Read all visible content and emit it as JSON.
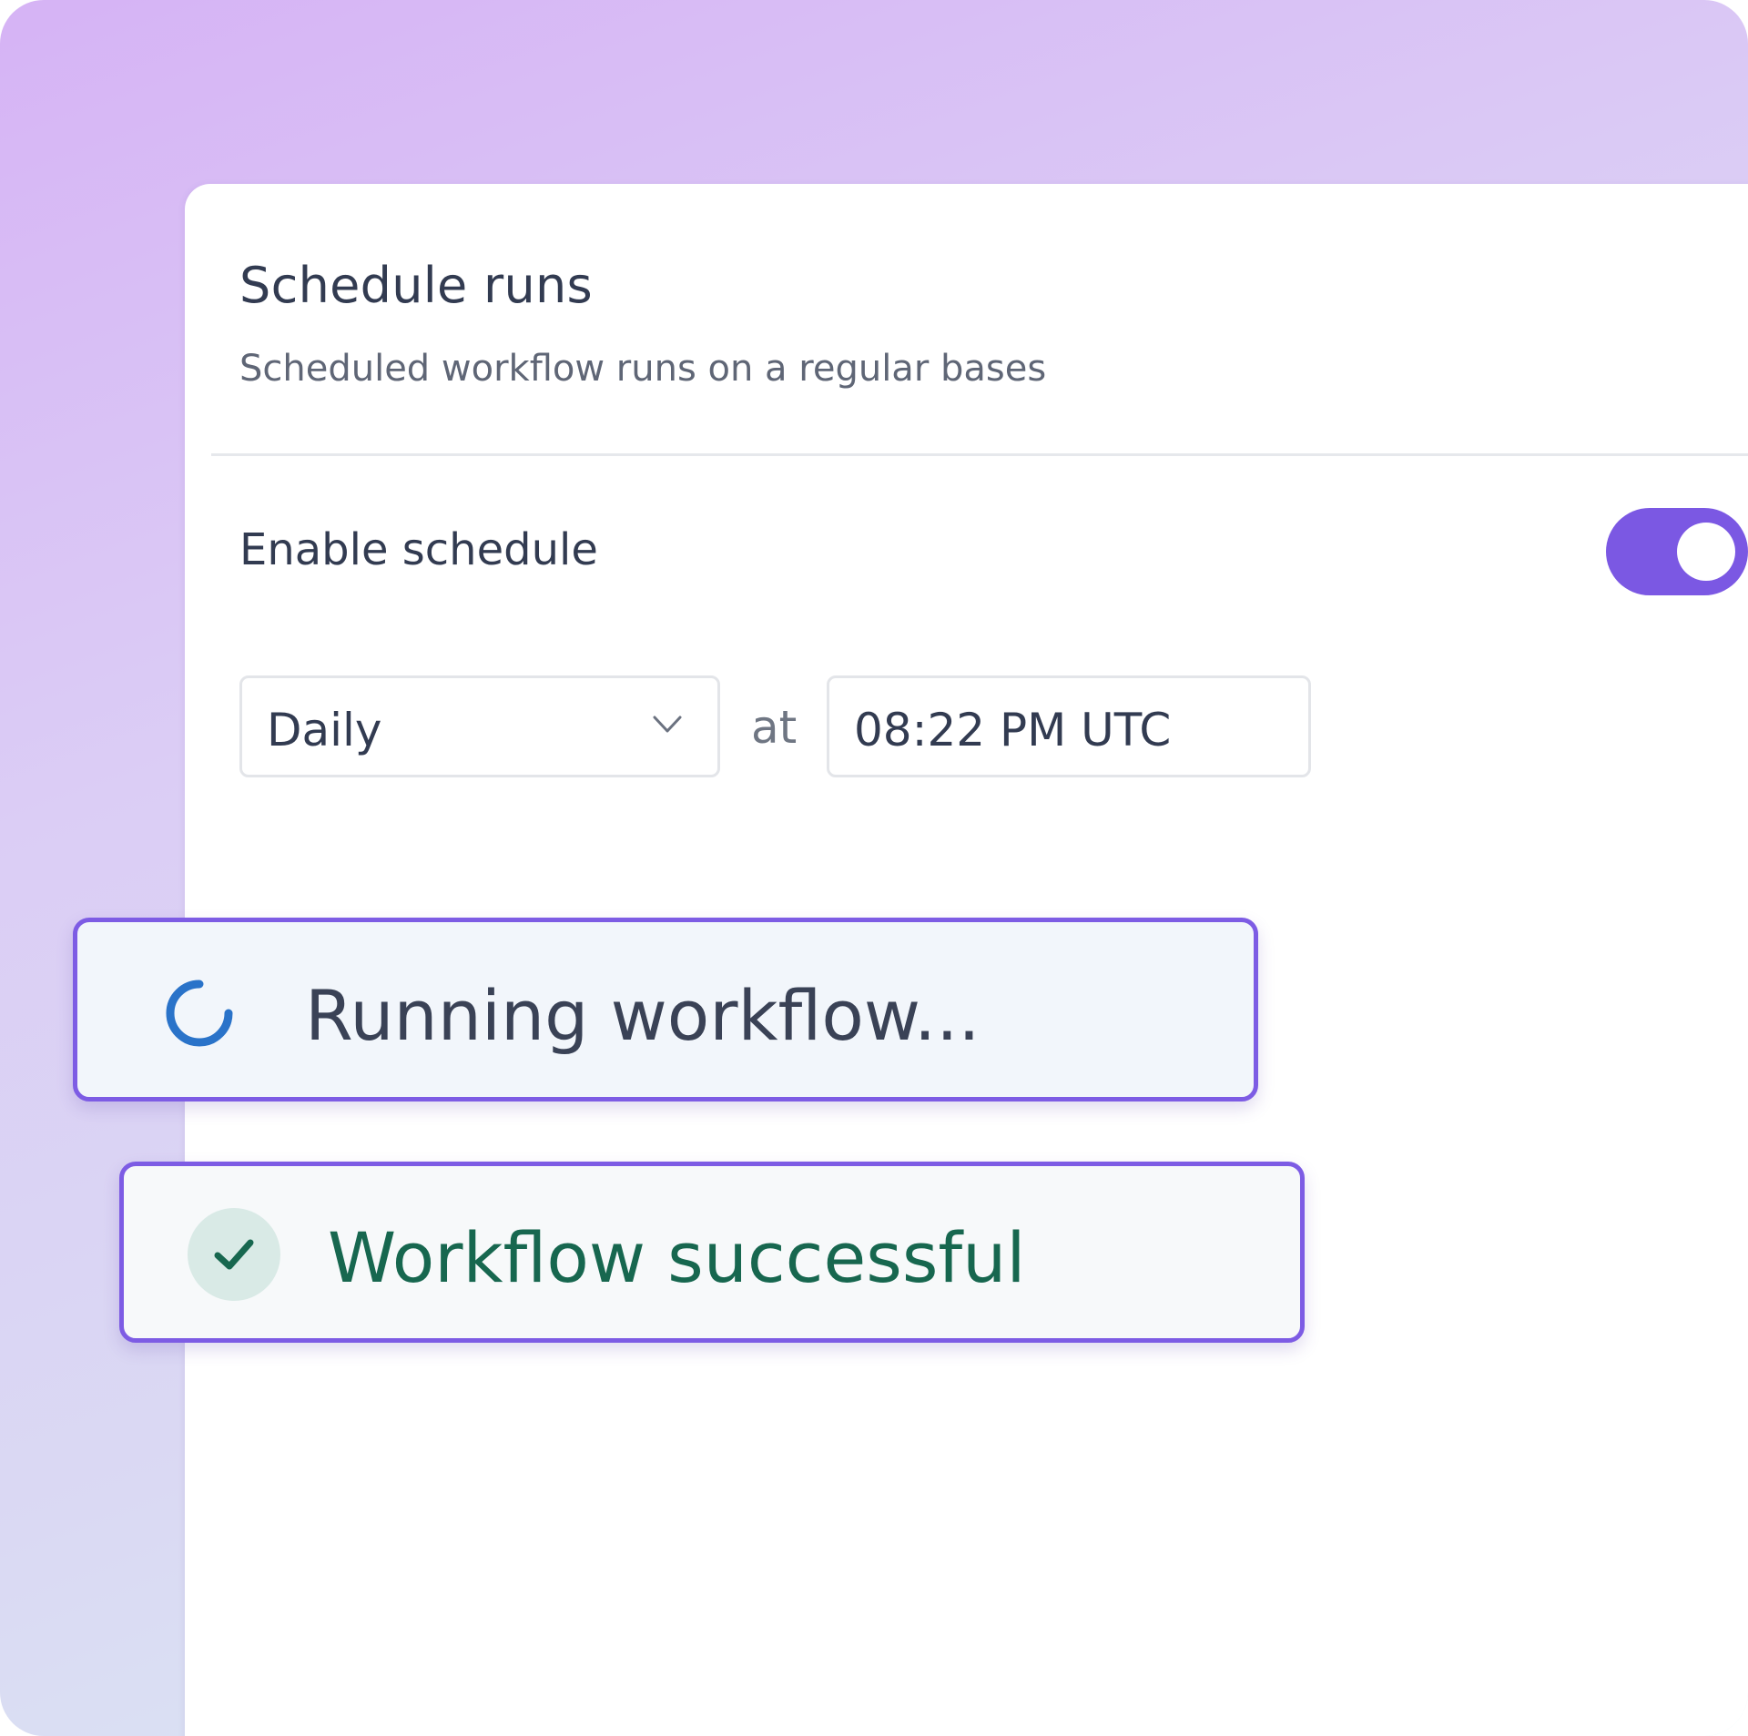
{
  "schedule": {
    "title": "Schedule runs",
    "subtitle": "Scheduled workflow runs on a regular bases"
  },
  "enable": {
    "label": "Enable schedule",
    "toggle_on": true
  },
  "frequency": {
    "selected": "Daily"
  },
  "time": {
    "at_label": "at",
    "value": "08:22 PM UTC"
  },
  "status": {
    "running_text": "Running workflow...",
    "success_text": "Workflow successful"
  },
  "icons": {
    "dropdown": "chevron-down-icon",
    "running": "spinner-icon",
    "success": "check-icon"
  },
  "colors": {
    "accent": "#7b58e3",
    "spinner": "#2a73c9",
    "success": "#17674f",
    "success_bg": "#d9eae6",
    "text_primary": "#323b51",
    "text_secondary": "#5f6676"
  }
}
